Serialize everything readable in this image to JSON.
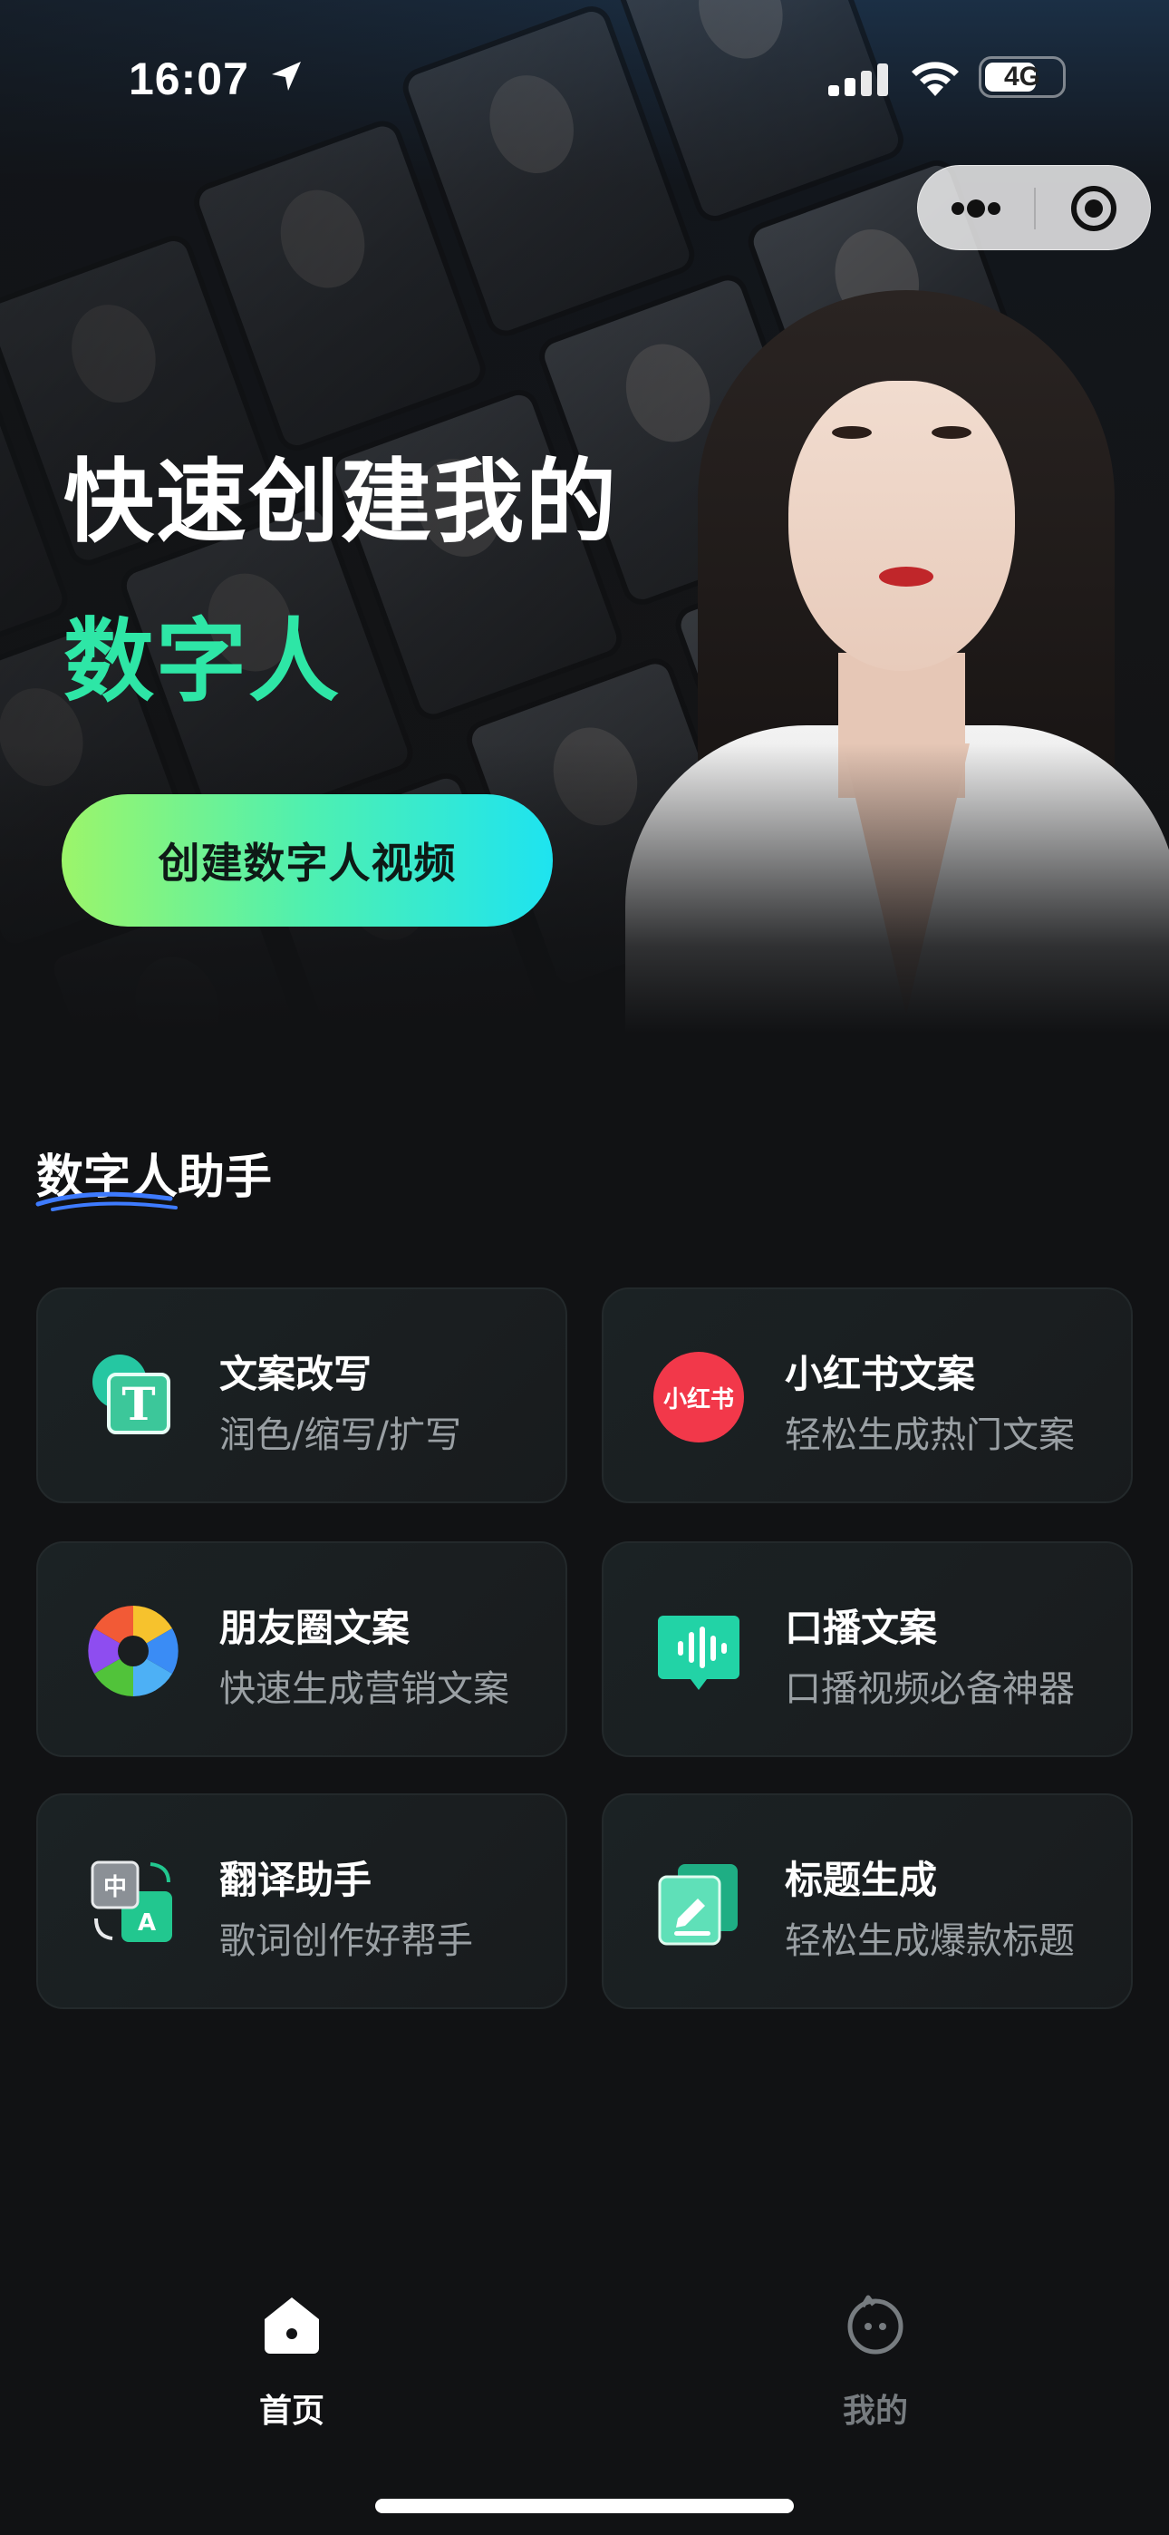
{
  "status_bar": {
    "time": "16:07",
    "network": "4G"
  },
  "capsule": {
    "more_icon": "more-dots-icon",
    "close_icon": "target-circle-icon"
  },
  "hero": {
    "title_line1": "快速创建我的",
    "title_line2": "数字人",
    "cta_label": "创建数字人视频",
    "accent_color": "#2ee6a6"
  },
  "section": {
    "title": "数字人助手"
  },
  "cards": [
    {
      "title": "文案改写",
      "subtitle": "润色/缩写/扩写",
      "icon": "text-t-icon"
    },
    {
      "title": "小红书文案",
      "subtitle": "轻松生成热门文案",
      "icon": "xiaohongshu-logo-icon",
      "icon_text": "小红书"
    },
    {
      "title": "朋友圈文案",
      "subtitle": "快速生成营销文案",
      "icon": "camera-aperture-icon"
    },
    {
      "title": "口播文案",
      "subtitle": "口播视频必备神器",
      "icon": "audio-wave-icon"
    },
    {
      "title": "翻译助手",
      "subtitle": "歌词创作好帮手",
      "icon": "translate-icon",
      "icon_text_a": "中",
      "icon_text_b": "A"
    },
    {
      "title": "标题生成",
      "subtitle": "轻松生成爆款标题",
      "icon": "edit-note-icon"
    }
  ],
  "tabbar": {
    "items": [
      {
        "label": "首页",
        "icon": "home-icon",
        "active": true
      },
      {
        "label": "我的",
        "icon": "profile-face-icon",
        "active": false
      }
    ]
  }
}
